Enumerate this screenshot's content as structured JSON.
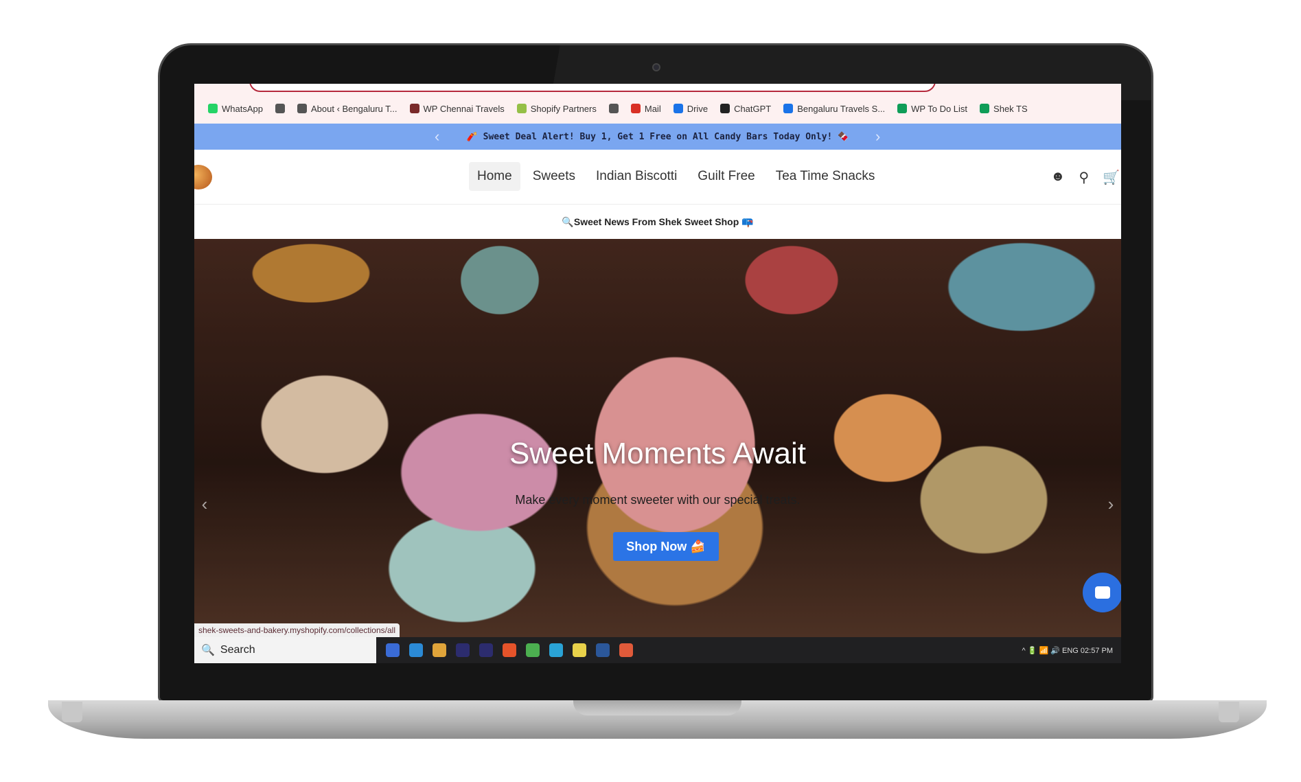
{
  "bookmarks": [
    {
      "label": "WhatsApp",
      "icon": "whatsapp-icon",
      "color": "#25d366"
    },
    {
      "label": "",
      "icon": "globe-icon",
      "color": "#555555"
    },
    {
      "label": "About ‹ Bengaluru T...",
      "icon": "globe-icon",
      "color": "#555555"
    },
    {
      "label": "WP Chennai Travels",
      "icon": "site-icon",
      "color": "#7a2a2a"
    },
    {
      "label": "Shopify Partners",
      "icon": "shopify-icon",
      "color": "#95bf47"
    },
    {
      "label": "",
      "icon": "globe-icon",
      "color": "#555555"
    },
    {
      "label": "Mail",
      "icon": "gmail-icon",
      "color": "#d93025"
    },
    {
      "label": "Drive",
      "icon": "drive-icon",
      "color": "#1a73e8"
    },
    {
      "label": "ChatGPT",
      "icon": "chatgpt-icon",
      "color": "#222222"
    },
    {
      "label": "Bengaluru Travels S...",
      "icon": "drive-icon",
      "color": "#1a73e8"
    },
    {
      "label": "WP To Do List",
      "icon": "sheets-icon",
      "color": "#0f9d58"
    },
    {
      "label": "Shek TS",
      "icon": "sheets-icon",
      "color": "#0f9d58"
    }
  ],
  "promo": {
    "text": "🧨 Sweet Deal Alert! Buy 1, Get 1 Free on All Candy Bars Today Only! 🍫",
    "prev": "‹",
    "next": "›"
  },
  "nav": {
    "items": [
      "Home",
      "Sweets",
      "Indian Biscotti",
      "Guilt Free",
      "Tea Time Snacks"
    ],
    "active": "Home",
    "icons": [
      "account-icon",
      "search-icon",
      "cart-icon"
    ]
  },
  "news": {
    "text": "🔍Sweet News From Shek Sweet Shop 📪"
  },
  "hero": {
    "title": "Sweet Moments Await",
    "subtitle": "Make every moment sweeter with our special treats.",
    "button": "Shop Now 🍰",
    "prev": "‹",
    "next": "›"
  },
  "status_url": "shek-sweets-and-bakery.myshopify.com/collections/all",
  "taskbar": {
    "search": "Search",
    "search_icon": "🔍",
    "apps": [
      "#3a6bd6",
      "#2b8ad6",
      "#e0a43a",
      "#2c2c6e",
      "#2c2c6e",
      "#e5532a",
      "#4caf50",
      "#2aa3d6",
      "#e8d14a",
      "#2b579a",
      "#e05a3a"
    ],
    "tray": "^  🔋  📶  🔊  ENG  02:57 PM"
  },
  "colors": {
    "promo_bg": "#7aa6f0",
    "button": "#2b74e6",
    "chat": "#2b6fe0"
  }
}
